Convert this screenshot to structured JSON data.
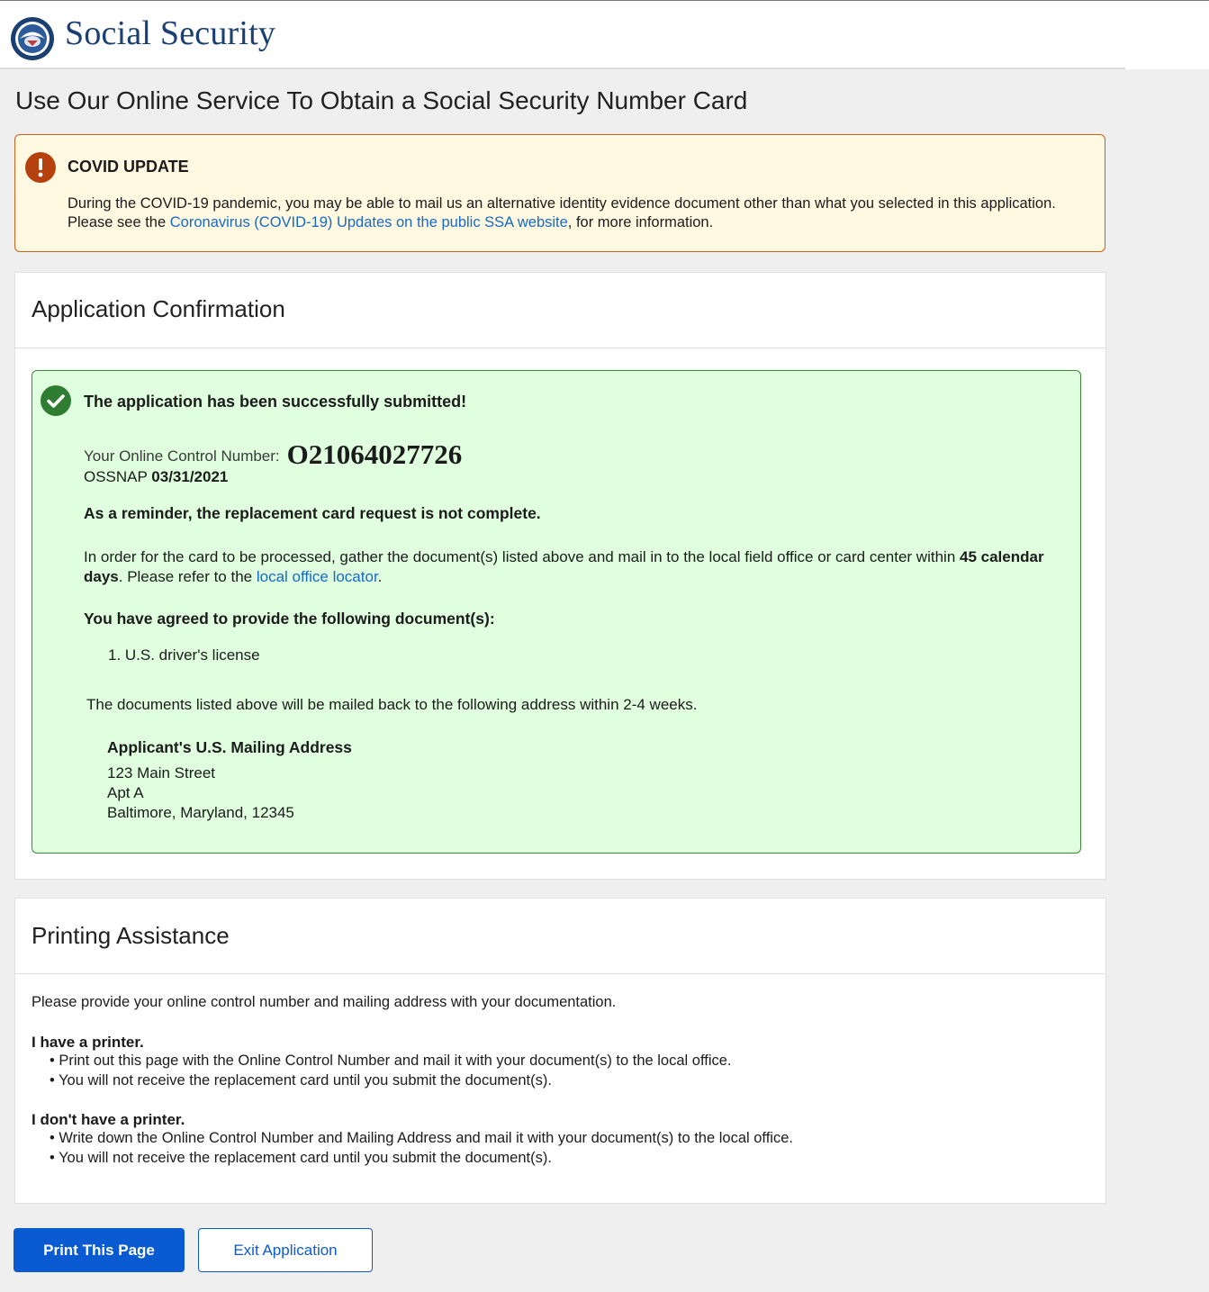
{
  "header": {
    "brand": "Social Security",
    "logo_icon": "ssa-seal-icon"
  },
  "page": {
    "title": "Use Our Online Service To Obtain a Social Security Number Card"
  },
  "covid_alert": {
    "icon": "warning-icon",
    "heading": "COVID UPDATE",
    "text_before": "During the COVID-19 pandemic, you may be able to mail us an alternative identity evidence document other than what you selected in this application. Please see the ",
    "link_text": "Coronavirus (COVID-19) Updates on the public SSA website",
    "text_after": ", for more information.",
    "accent_color": "#c9601d"
  },
  "confirmation": {
    "panel_title": "Application Confirmation",
    "success_icon": "check-circle-icon",
    "success_heading": "The application has been successfully submitted!",
    "control_number_label": "Your Online Control Number:",
    "control_number": "O21064027726",
    "ossnap_label": "OSSNAP",
    "ossnap_date": "03/31/2021",
    "reminder": "As a reminder, the replacement card request is not complete.",
    "order_text_1": "In order for the card to be processed, gather the document(s) listed above and mail in to the local field office or card center within ",
    "order_days": "45 calendar days",
    "order_text_2": ". Please refer to the ",
    "office_link": "local office locator",
    "order_text_3": ".",
    "agreed_heading": "You have agreed to provide the following document(s):",
    "documents": [
      "1. U.S. driver's license"
    ],
    "mailed_back_text": "The documents listed above will be mailed back to the following address within 2-4 weeks.",
    "address_title": "Applicant's U.S. Mailing Address",
    "address_lines": [
      "123 Main Street",
      "Apt A",
      "Baltimore, Maryland, 12345"
    ],
    "accent_color": "#3d8a3d"
  },
  "printing": {
    "panel_title": "Printing Assistance",
    "intro": "Please provide your online control number and mailing address with your documentation.",
    "have_printer": {
      "heading": "I have a printer.",
      "bullets": [
        "• Print out this page with the Online Control Number and mail it with your document(s) to the local office.",
        "• You will not receive the replacement card until you submit the document(s)."
      ]
    },
    "no_printer": {
      "heading": "I don't have a printer.",
      "bullets": [
        "• Write down the Online Control Number and Mailing Address and mail it with your document(s) to the local office.",
        "• You will not receive the replacement card until you submit the document(s)."
      ]
    }
  },
  "actions": {
    "print_label": "Print This Page",
    "exit_label": "Exit Application",
    "primary_color": "#0a5bd1"
  }
}
